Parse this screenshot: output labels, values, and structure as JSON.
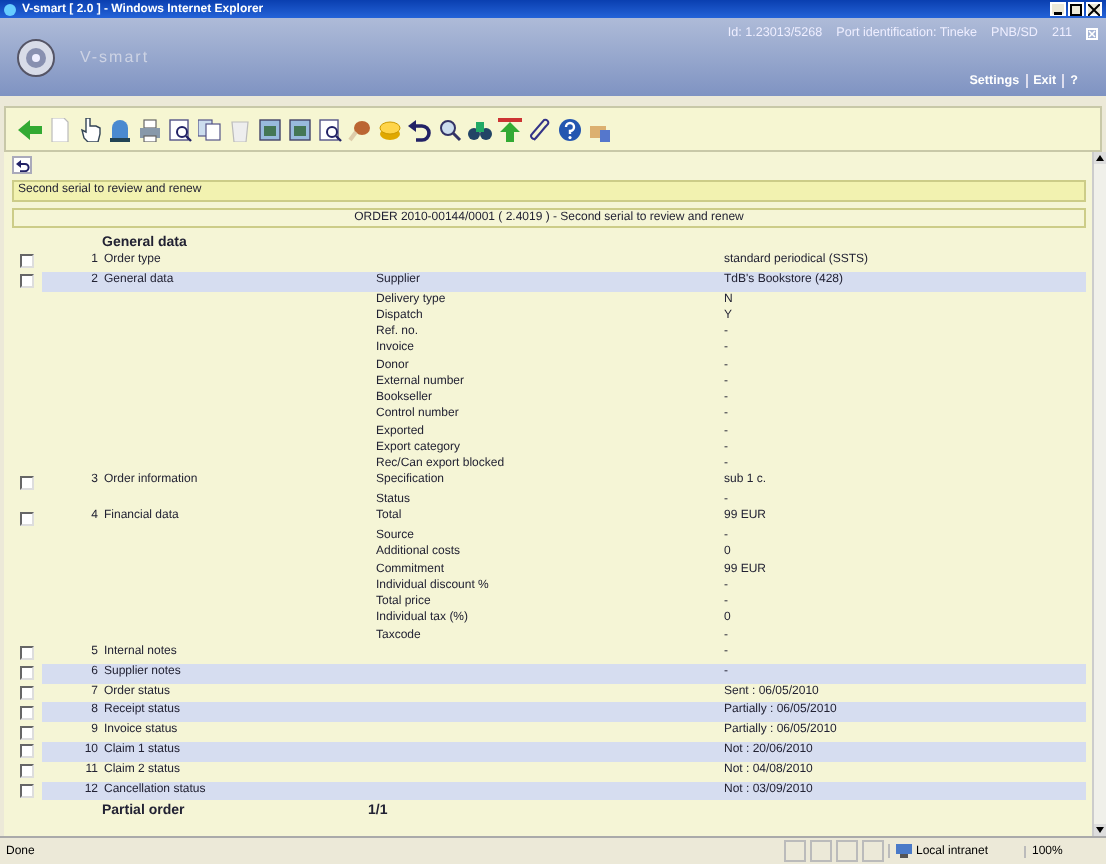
{
  "window": {
    "title": "V-smart [ 2.0 ] - Windows Internet Explorer"
  },
  "header": {
    "app_name": "V-smart",
    "id": "Id: 1.23013/5268",
    "port": "Port identification: Tineke",
    "location": "PNB/SD",
    "number": "211",
    "links": [
      "Settings",
      "Exit",
      "?"
    ]
  },
  "message": "Second serial to review and renew",
  "order_title": "ORDER 2010-00144/0001 ( 2.4019 ) - Second serial to review and renew",
  "section_title": "General data",
  "rows": [
    {
      "number": "1",
      "label": "Order type",
      "checked": false,
      "highlighted": false,
      "lines": [
        {
          "value": "standard periodical (SSTS)"
        }
      ]
    },
    {
      "number": "2",
      "label": "General data",
      "checked": false,
      "highlighted": true,
      "lines": [
        {
          "field": "Supplier",
          "value": "TdB's Bookstore (428)"
        },
        {
          "field": "Delivery type",
          "value": "N"
        },
        {
          "field": "Dispatch",
          "value": "Y"
        },
        {
          "field": "Ref. no.",
          "value": "-"
        },
        {
          "field": "Invoice",
          "value": "-"
        },
        {
          "field": "Donor",
          "value": "-"
        },
        {
          "field": "External number",
          "value": "-"
        },
        {
          "field": "Bookseller",
          "value": "-"
        },
        {
          "field": "Control number",
          "value": "-"
        },
        {
          "field": "Exported",
          "value": "-"
        },
        {
          "field": "Export category",
          "value": "-"
        },
        {
          "field": "Rec/Can export blocked",
          "value": "-"
        }
      ]
    },
    {
      "number": "3",
      "label": "Order information",
      "checked": false,
      "highlighted": false,
      "lines": [
        {
          "field": "Specification",
          "value": "sub 1 c."
        },
        {
          "field": "Status",
          "value": "-"
        }
      ]
    },
    {
      "number": "4",
      "label": "Financial data",
      "checked": false,
      "highlighted": false,
      "lines": [
        {
          "field": "Total",
          "value": "99 EUR"
        },
        {
          "field": "Source",
          "value": "-"
        },
        {
          "field": "Additional costs",
          "value": "0"
        },
        {
          "field": "Commitment",
          "value": "99 EUR"
        },
        {
          "field": "Individual discount %",
          "value": "-"
        },
        {
          "field": "Total price",
          "value": "-"
        },
        {
          "field": "Individual tax (%)",
          "value": "0"
        },
        {
          "field": "Taxcode",
          "value": "-"
        }
      ]
    },
    {
      "number": "5",
      "label": "Internal notes",
      "checked": false,
      "highlighted": false,
      "lines": [
        {
          "value": "-"
        }
      ]
    },
    {
      "number": "6",
      "label": "Supplier notes",
      "checked": false,
      "highlighted": true,
      "lines": [
        {
          "value": "-"
        }
      ]
    },
    {
      "number": "7",
      "label": "Order status",
      "checked": false,
      "highlighted": false,
      "lines": [
        {
          "value": "Sent : 06/05/2010"
        }
      ]
    },
    {
      "number": "8",
      "label": "Receipt status",
      "checked": false,
      "highlighted": true,
      "lines": [
        {
          "value": "Partially : 06/05/2010"
        }
      ]
    },
    {
      "number": "9",
      "label": "Invoice status",
      "checked": false,
      "highlighted": false,
      "lines": [
        {
          "value": "Partially : 06/05/2010"
        }
      ]
    },
    {
      "number": "10",
      "label": "Claim 1 status",
      "checked": false,
      "highlighted": true,
      "lines": [
        {
          "value": "Not : 20/06/2010"
        }
      ]
    },
    {
      "number": "11",
      "label": "Claim 2 status",
      "checked": false,
      "highlighted": false,
      "lines": [
        {
          "value": "Not : 04/08/2010"
        }
      ]
    },
    {
      "number": "12",
      "label": "Cancellation status",
      "checked": false,
      "highlighted": true,
      "lines": [
        {
          "value": "Not : 03/09/2010"
        }
      ]
    }
  ],
  "footer": {
    "label": "Partial order",
    "value": "1/1"
  },
  "status_bar": {
    "text": "Done",
    "zone": "Local intranet",
    "zoom": "100%"
  }
}
